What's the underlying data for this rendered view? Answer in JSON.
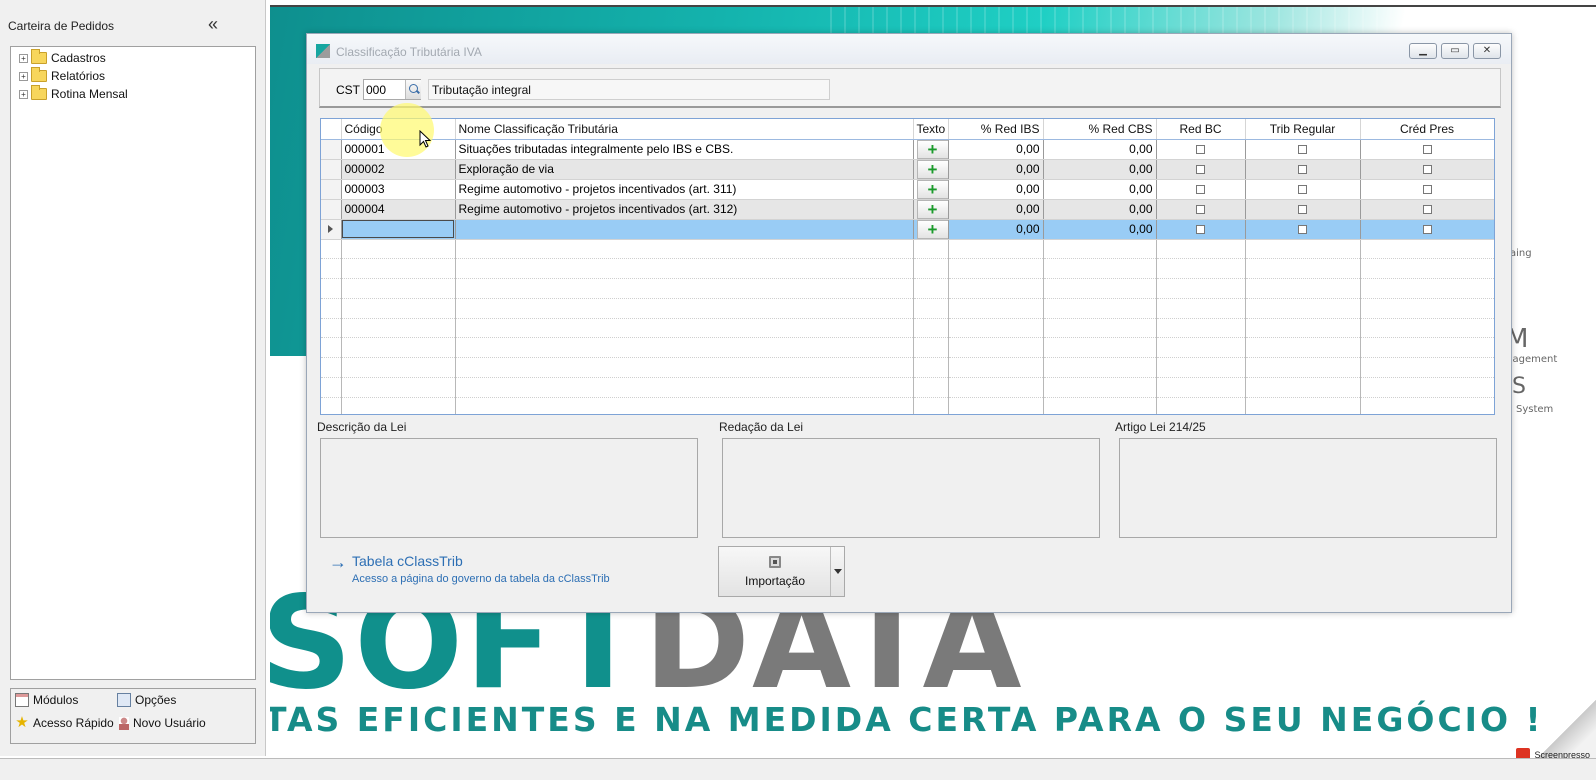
{
  "left_panel": {
    "title": "Carteira de Pedidos",
    "tree": [
      {
        "label": "Cadastros"
      },
      {
        "label": "Relatórios"
      },
      {
        "label": "Rotina Mensal"
      }
    ],
    "nav": {
      "modulos": "Módulos",
      "opcoes": "Opções",
      "acesso_rapido": "Acesso Rápido",
      "novo_usuario": "Novo Usuário"
    }
  },
  "background": {
    "brand_part1": "SOFT",
    "brand_part2": "DATA",
    "slogan": "TAS EFICIENTES E NA MEDIDA CERTA PARA O SEU NEGÓCIO !",
    "side_texts": [
      "aing",
      "M",
      "anagement",
      "S",
      "System"
    ],
    "watermark": "Screenpresso"
  },
  "dialog": {
    "title": "Classificação Tributária IVA",
    "cst": {
      "label": "CST",
      "value": "000",
      "description": "Tributação integral"
    },
    "grid": {
      "columns": [
        "Código",
        "Nome Classificação Tributária",
        "Texto",
        "% Red IBS",
        "% Red CBS",
        "Red BC",
        "Trib Regular",
        "Créd Pres"
      ],
      "rows": [
        {
          "codigo": "000001",
          "nome": "Situações tributadas integralmente pelo IBS e CBS.",
          "red_ibs": "0,00",
          "red_cbs": "0,00"
        },
        {
          "codigo": "000002",
          "nome": "Exploração de via",
          "red_ibs": "0,00",
          "red_cbs": "0,00"
        },
        {
          "codigo": "000003",
          "nome": "Regime automotivo - projetos incentivados (art. 311)",
          "red_ibs": "0,00",
          "red_cbs": "0,00"
        },
        {
          "codigo": "000004",
          "nome": "Regime automotivo - projetos incentivados (art. 312)",
          "red_ibs": "0,00",
          "red_cbs": "0,00"
        },
        {
          "codigo": "",
          "nome": "",
          "red_ibs": "0,00",
          "red_cbs": "0,00"
        }
      ]
    },
    "sections": {
      "descricao": "Descrição da Lei",
      "redacao": "Redação da Lei",
      "artigo": "Artigo Lei 214/25"
    },
    "link": {
      "title": "Tabela cClassTrib",
      "subtitle": "Acesso a página do governo da tabela da cClassTrib"
    },
    "import_button": "Importação"
  },
  "colors": {
    "teal": "#14b3ad",
    "selected_row": "#99ccf5",
    "link": "#2d6fb4",
    "plus": "#1b9a2b"
  }
}
